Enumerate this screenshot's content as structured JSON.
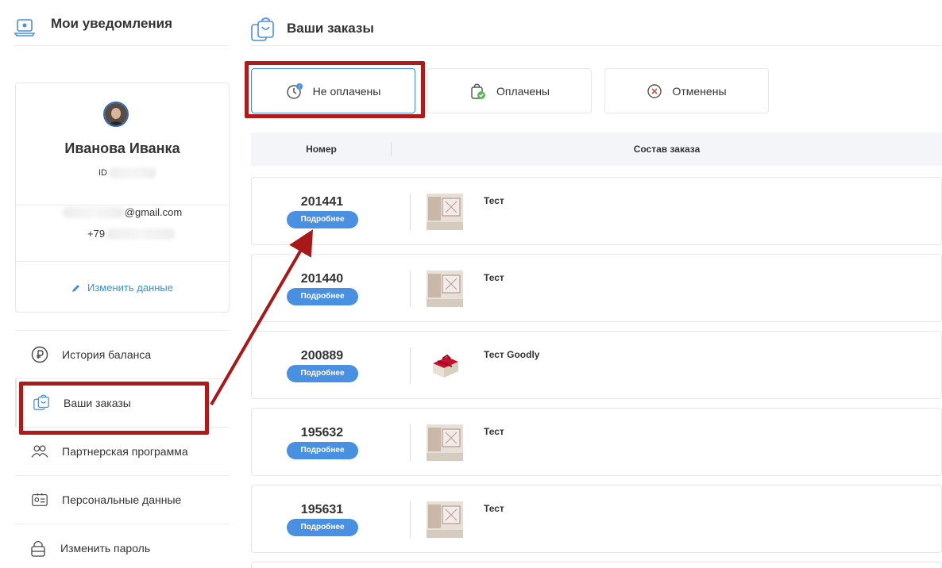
{
  "left": {
    "title": "Мои уведомления",
    "profile": {
      "name": "Иванова Иванка",
      "id_prefix": "ID",
      "email_suffix": "@gmail.com",
      "phone_prefix": "+79",
      "edit_label": "Изменить данные"
    },
    "menu": [
      {
        "label": "История баланса",
        "icon": "ruble-icon"
      },
      {
        "label": "Ваши заказы",
        "icon": "orders-bag-icon"
      },
      {
        "label": "Партнерская программа",
        "icon": "partners-icon"
      },
      {
        "label": "Персональные данные",
        "icon": "id-card-icon"
      },
      {
        "label": "Изменить пароль",
        "icon": "lock-icon"
      }
    ]
  },
  "main": {
    "title": "Ваши заказы",
    "tabs": [
      {
        "label": "Не оплачены",
        "icon": "clock-badge-icon",
        "active": true
      },
      {
        "label": "Оплачены",
        "icon": "paid-bag-icon",
        "active": false
      },
      {
        "label": "Отменены",
        "icon": "cancel-circle-icon",
        "active": false
      }
    ],
    "table_headers": {
      "number": "Номер",
      "contents": "Состав заказа"
    },
    "details_label": "Подробнее",
    "orders": [
      {
        "number": "201441",
        "item": "Тест",
        "thumb": "room"
      },
      {
        "number": "201440",
        "item": "Тест",
        "thumb": "room"
      },
      {
        "number": "200889",
        "item": "Тест Goodly",
        "thumb": "gift"
      },
      {
        "number": "195632",
        "item": "Тест",
        "thumb": "room"
      },
      {
        "number": "195631",
        "item": "Тест",
        "thumb": "room"
      }
    ]
  },
  "colors": {
    "accent": "#4a90e2",
    "highlight": "#b01a1a",
    "link": "#3f8fd8"
  }
}
